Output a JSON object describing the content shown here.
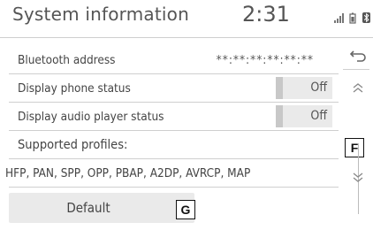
{
  "header": {
    "title": "System information",
    "clock": "2:31"
  },
  "rows": [
    {
      "label": "Bluetooth address",
      "value": "**:**:**:**:**:**"
    },
    {
      "label": "Display phone status",
      "toggle": "Off"
    },
    {
      "label": "Display audio player status",
      "toggle": "Off"
    },
    {
      "label": "Supported profiles:"
    },
    {
      "label": "HFP, PAN, SPP, OPP, PBAP, A2DP, AVRCP, MAP"
    }
  ],
  "default_button": "Default",
  "callouts": {
    "f": "F",
    "g": "G"
  },
  "icons": {
    "status": [
      "signal-bars-icon",
      "battery-icon",
      "bluetooth-icon"
    ],
    "side": [
      "back-arrow-icon",
      "scroll-up-icon",
      "scroll-down-icon"
    ]
  }
}
